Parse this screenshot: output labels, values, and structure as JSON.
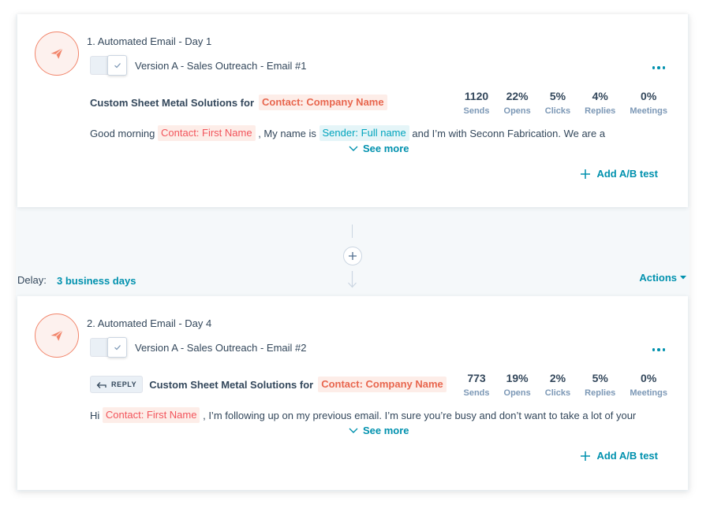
{
  "steps": [
    {
      "title": "1. Automated Email - Day 1",
      "version": "Version A - Sales Outreach - Email #1",
      "subject_prefix": "Custom Sheet Metal Solutions for",
      "subject_token": "Contact: Company Name",
      "stats": [
        {
          "value": "1120",
          "label": "Sends"
        },
        {
          "value": "22%",
          "label": "Opens"
        },
        {
          "value": "5%",
          "label": "Clicks"
        },
        {
          "value": "4%",
          "label": "Replies"
        },
        {
          "value": "0%",
          "label": "Meetings"
        }
      ],
      "body": {
        "t1": "Good morning ",
        "token1": "Contact: First Name",
        "t2": " , My name is ",
        "token2": "Sender: Full name",
        "t3": " and I’m with Seconn Fabrication. We are a"
      },
      "see_more": "See more",
      "add_ab": "Add A/B test"
    },
    {
      "title": "2. Automated Email - Day 4",
      "version": "Version A - Sales Outreach - Email #2",
      "reply_label": "REPLY",
      "subject_prefix": "Custom Sheet Metal Solutions for",
      "subject_token": "Contact: Company Name",
      "stats": [
        {
          "value": "773",
          "label": "Sends"
        },
        {
          "value": "19%",
          "label": "Opens"
        },
        {
          "value": "2%",
          "label": "Clicks"
        },
        {
          "value": "5%",
          "label": "Replies"
        },
        {
          "value": "0%",
          "label": "Meetings"
        }
      ],
      "body": {
        "t1": "Hi ",
        "token1": "Contact: First Name",
        "t2": " , I’m following up on my previous email. I’m sure you’re busy and don’t want to take a lot of your"
      },
      "see_more": "See more",
      "add_ab": "Add A/B test"
    }
  ],
  "delay": {
    "label": "Delay:",
    "value": "3 business days"
  },
  "actions_label": "Actions",
  "colors": {
    "accent": "#0091ae",
    "brand_orange": "#f2856b",
    "token_orange_bg": "#fdede8",
    "token_teal_bg": "#e5f5f8"
  }
}
